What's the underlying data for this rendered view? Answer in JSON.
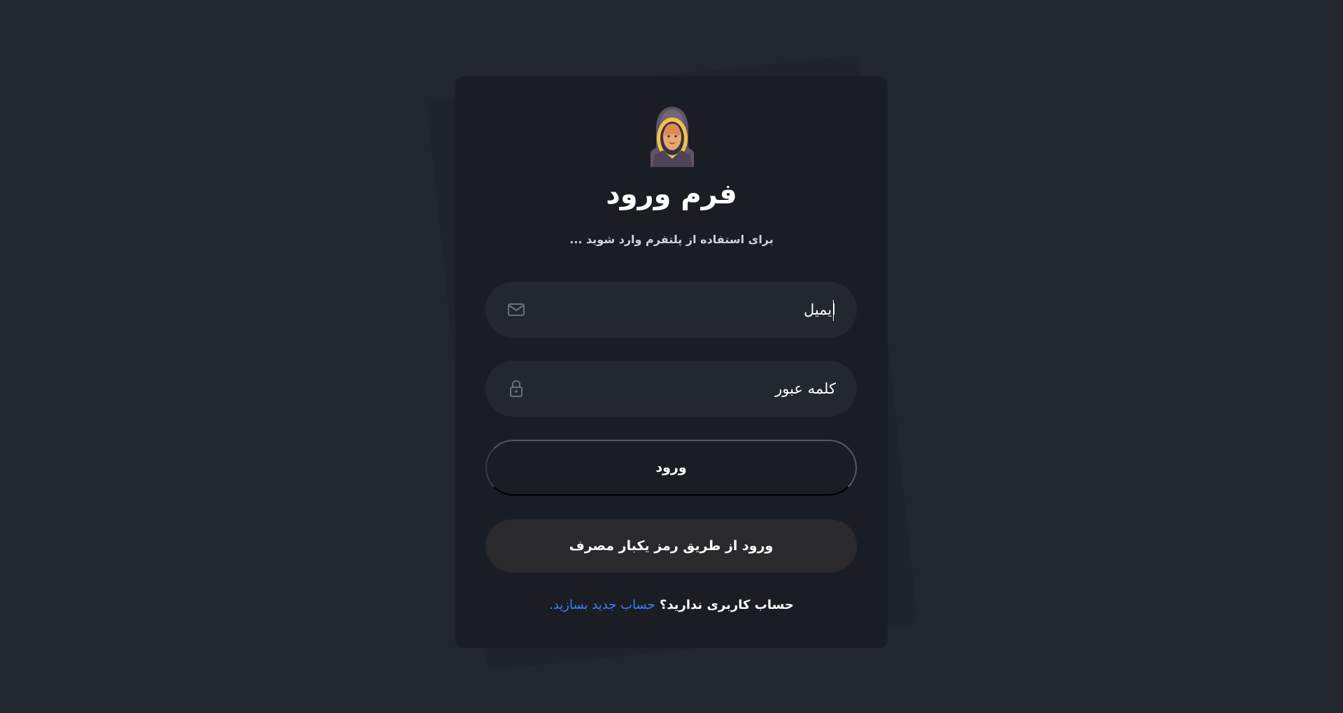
{
  "form": {
    "title": "فرم ورود",
    "subtitle": "برای استفاده از پلتفرم وارد شوید ...",
    "email_placeholder": "ایمیل",
    "password_placeholder": "کلمه عبور",
    "login_label": "ورود",
    "otp_label": "ورود از طریق رمز یکبار مصرف",
    "signup_text": "حساب کاربری ندارید؟",
    "signup_link": "حساب جدید بسازید."
  },
  "icons": {
    "avatar": "hooded-user-avatar-icon",
    "email": "mail-icon",
    "password": "lock-icon"
  },
  "colors": {
    "background": "#22272f",
    "card": "#1b1d24",
    "field": "#232830",
    "otp_button": "#2a2a2c",
    "link": "#3b82f6"
  }
}
